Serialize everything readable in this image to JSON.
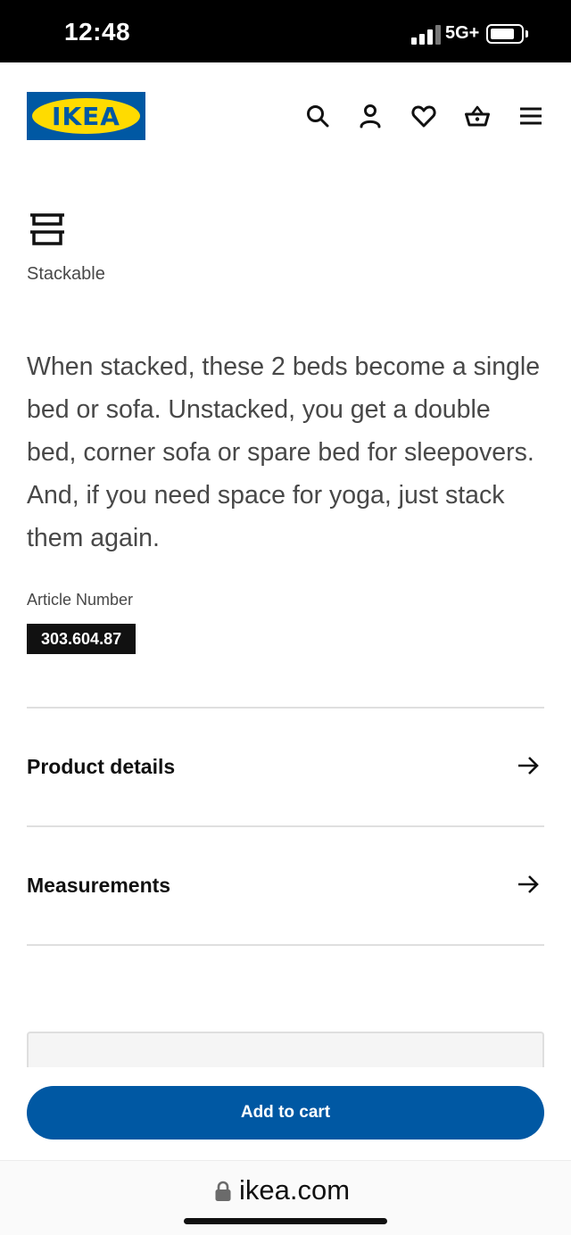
{
  "status_bar": {
    "time": "12:48",
    "network": "5G+",
    "icons": [
      "signal-icon",
      "battery-icon"
    ]
  },
  "header": {
    "logo_text": "IKEA",
    "icons": [
      "search-icon",
      "account-icon",
      "heart-icon",
      "cart-icon",
      "menu-icon"
    ]
  },
  "feature": {
    "icon": "stackable-icon",
    "label": "Stackable"
  },
  "description": "When stacked, these 2 beds become a single bed or sofa. Unstacked, you get a double bed, corner sofa or spare bed for sleepovers. And, if you need space for yoga, just stack them again.",
  "article": {
    "label": "Article Number",
    "number": "303.604.87"
  },
  "sections": [
    {
      "label": "Product details",
      "icon": "arrow-right-icon"
    },
    {
      "label": "Measurements",
      "icon": "arrow-right-icon"
    }
  ],
  "cta": {
    "label": "Add to cart"
  },
  "browser": {
    "url": "ikea.com",
    "icon": "lock-icon"
  },
  "colors": {
    "brand_blue": "#0058a3",
    "brand_yellow": "#ffdb00",
    "text_primary": "#111111",
    "text_secondary": "#484848"
  }
}
